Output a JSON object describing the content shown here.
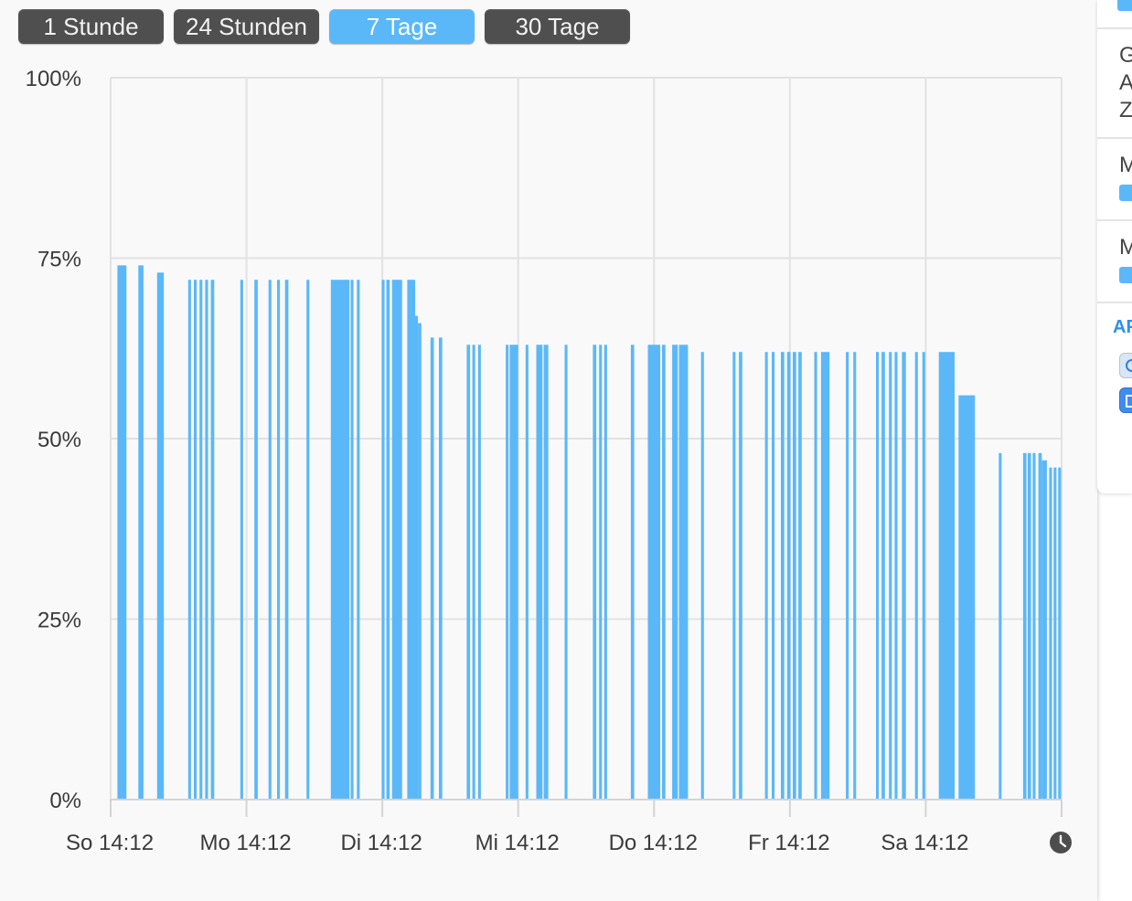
{
  "range_tabs": [
    "1 Stunde",
    "24 Stunden",
    "7 Tage",
    "30 Tage"
  ],
  "active_tab_index": 2,
  "colors": {
    "bar": "#5bb8f8",
    "accent": "#5bb8f8",
    "tab_inactive": "#4f4f4f",
    "grid": "#e2e2e2"
  },
  "chart_data": {
    "type": "bar",
    "title": "",
    "xlabel": "",
    "ylabel": "",
    "x_unit": "hours since So 14:12",
    "xlim": [
      0,
      168
    ],
    "ylim": [
      0,
      100
    ],
    "yticks": [
      "100%",
      "75%",
      "50%",
      "25%",
      "0%"
    ],
    "ytick_values": [
      100,
      75,
      50,
      25,
      0
    ],
    "xticks": [
      "So 14:12",
      "Mo 14:12",
      "Di 14:12",
      "Mi 14:12",
      "Do 14:12",
      "Fr 14:12",
      "Sa 14:12"
    ],
    "xtick_values": [
      0,
      24,
      48,
      72,
      96,
      120,
      144
    ],
    "grid": true,
    "series": [
      {
        "values": [
          [
            1.2,
            2.8,
            74
          ],
          [
            4.9,
            5.8,
            74
          ],
          [
            8.2,
            9.4,
            73
          ],
          [
            13.7,
            14.2,
            72
          ],
          [
            14.7,
            15.2,
            72
          ],
          [
            15.7,
            16.2,
            72
          ],
          [
            16.7,
            17.2,
            72
          ],
          [
            17.7,
            18.3,
            72
          ],
          [
            22.9,
            23.4,
            72
          ],
          [
            25.4,
            26.0,
            72
          ],
          [
            27.9,
            28.4,
            72
          ],
          [
            29.4,
            29.9,
            72
          ],
          [
            30.8,
            31.4,
            72
          ],
          [
            34.6,
            35.1,
            72
          ],
          [
            38.9,
            42.2,
            72
          ],
          [
            42.4,
            42.9,
            72
          ],
          [
            43.5,
            44.0,
            72
          ],
          [
            47.9,
            48.4,
            72
          ],
          [
            48.7,
            49.3,
            72
          ],
          [
            49.7,
            51.5,
            72
          ],
          [
            52.4,
            53.8,
            72
          ],
          [
            53.8,
            54.3,
            67
          ],
          [
            54.3,
            54.9,
            66
          ],
          [
            56.5,
            57.1,
            64
          ],
          [
            58.0,
            58.6,
            64
          ],
          [
            62.9,
            63.5,
            63
          ],
          [
            63.9,
            64.4,
            63
          ],
          [
            64.9,
            65.4,
            63
          ],
          [
            69.8,
            70.3,
            63
          ],
          [
            70.5,
            72.0,
            63
          ],
          [
            73.3,
            73.8,
            63
          ],
          [
            75.2,
            76.3,
            63
          ],
          [
            76.5,
            77.3,
            63
          ],
          [
            80.2,
            80.7,
            63
          ],
          [
            85.2,
            85.8,
            63
          ],
          [
            86.3,
            86.8,
            63
          ],
          [
            87.2,
            87.7,
            63
          ],
          [
            91.9,
            92.5,
            63
          ],
          [
            94.9,
            97.1,
            63
          ],
          [
            97.4,
            98.0,
            63
          ],
          [
            99.2,
            100.2,
            63
          ],
          [
            100.4,
            102.0,
            63
          ],
          [
            104.3,
            104.8,
            62
          ],
          [
            109.9,
            110.4,
            62
          ],
          [
            111.0,
            111.6,
            62
          ],
          [
            115.6,
            116.1,
            62
          ],
          [
            116.8,
            117.3,
            62
          ],
          [
            118.4,
            119.0,
            62
          ],
          [
            119.5,
            120.1,
            62
          ],
          [
            120.5,
            121.1,
            62
          ],
          [
            121.5,
            122.1,
            62
          ],
          [
            124.3,
            124.8,
            62
          ],
          [
            125.5,
            127.0,
            62
          ],
          [
            129.9,
            130.4,
            62
          ],
          [
            131.2,
            131.7,
            62
          ],
          [
            135.2,
            135.7,
            62
          ],
          [
            136.2,
            136.8,
            62
          ],
          [
            137.5,
            138.0,
            62
          ],
          [
            138.5,
            139.0,
            62
          ],
          [
            139.8,
            140.5,
            62
          ],
          [
            142.1,
            142.6,
            62
          ],
          [
            143.4,
            143.9,
            62
          ],
          [
            146.3,
            149.1,
            62
          ],
          [
            149.8,
            152.7,
            56
          ],
          [
            156.9,
            157.4,
            48
          ],
          [
            161.2,
            161.8,
            48
          ],
          [
            162.0,
            162.6,
            48
          ],
          [
            162.9,
            163.4,
            48
          ],
          [
            163.9,
            164.5,
            48
          ],
          [
            164.5,
            165.4,
            47
          ],
          [
            165.8,
            166.3,
            46
          ],
          [
            166.6,
            167.1,
            46
          ],
          [
            167.4,
            167.9,
            46
          ]
        ]
      }
    ]
  }
}
